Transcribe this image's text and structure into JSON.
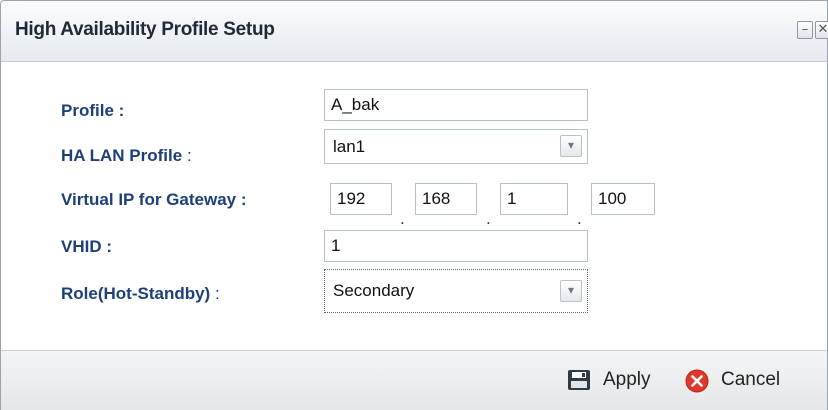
{
  "dialog": {
    "title": "High Availability Profile Setup",
    "minimize_symbol": "–",
    "close_symbol": "✕"
  },
  "form": {
    "profile": {
      "label": "Profile :",
      "value": "A_bak"
    },
    "ha_lan_profile": {
      "label": "HA LAN Profile",
      "colon": ":",
      "value": "lan1"
    },
    "virtual_ip": {
      "label": "Virtual IP for Gateway :",
      "octets": [
        "192",
        "168",
        "1",
        "100"
      ]
    },
    "vhid": {
      "label": "VHID :",
      "value": "1"
    },
    "role": {
      "label": "Role(Hot-Standby)",
      "colon": ":",
      "value": "Secondary"
    }
  },
  "footer": {
    "apply_label": "Apply",
    "cancel_label": "Cancel"
  },
  "colors": {
    "label_blue": "#1d3f7a",
    "cancel_red": "#e0392b",
    "apply_dark": "#2f3a45"
  },
  "icons": {
    "minimize": "minimize-icon",
    "close": "close-icon",
    "dropdown": "chevron-down-icon",
    "save": "save-icon",
    "cancel": "cancel-icon"
  }
}
